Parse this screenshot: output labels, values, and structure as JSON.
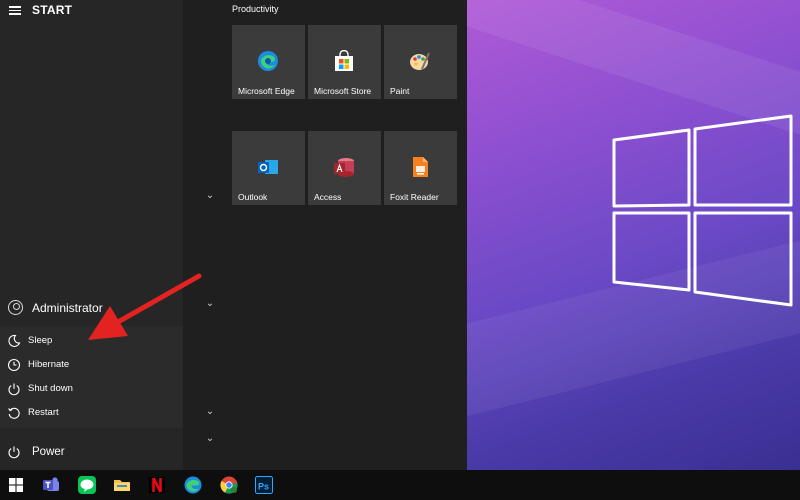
{
  "start_menu": {
    "title": "START",
    "user": {
      "name": "Administrator"
    },
    "power_options": [
      {
        "label": "Sleep",
        "icon": "moon-icon"
      },
      {
        "label": "Hibernate",
        "icon": "clock-icon"
      },
      {
        "label": "Shut down",
        "icon": "power-icon"
      },
      {
        "label": "Restart",
        "icon": "restart-icon"
      }
    ],
    "power_label": "Power"
  },
  "tile_group": {
    "title": "Productivity",
    "tiles": [
      {
        "label": "Microsoft Edge",
        "icon": "edge-icon"
      },
      {
        "label": "Microsoft Store",
        "icon": "store-icon"
      },
      {
        "label": "Paint",
        "icon": "paint-icon"
      },
      {
        "label": "Outlook",
        "icon": "outlook-icon"
      },
      {
        "label": "Access",
        "icon": "access-icon"
      },
      {
        "label": "Foxit Reader",
        "icon": "pdf-icon"
      }
    ]
  },
  "taskbar": {
    "items": [
      {
        "icon": "windows-start-icon"
      },
      {
        "icon": "teams-icon"
      },
      {
        "icon": "line-chat-icon"
      },
      {
        "icon": "file-explorer-icon"
      },
      {
        "icon": "netflix-icon"
      },
      {
        "icon": "edge-icon"
      },
      {
        "icon": "chrome-icon"
      },
      {
        "icon": "photoshop-icon"
      }
    ]
  },
  "colors": {
    "accent_red": "#e32222",
    "tile_bg": "#3b3b3b",
    "menu_bg": "#262626"
  }
}
